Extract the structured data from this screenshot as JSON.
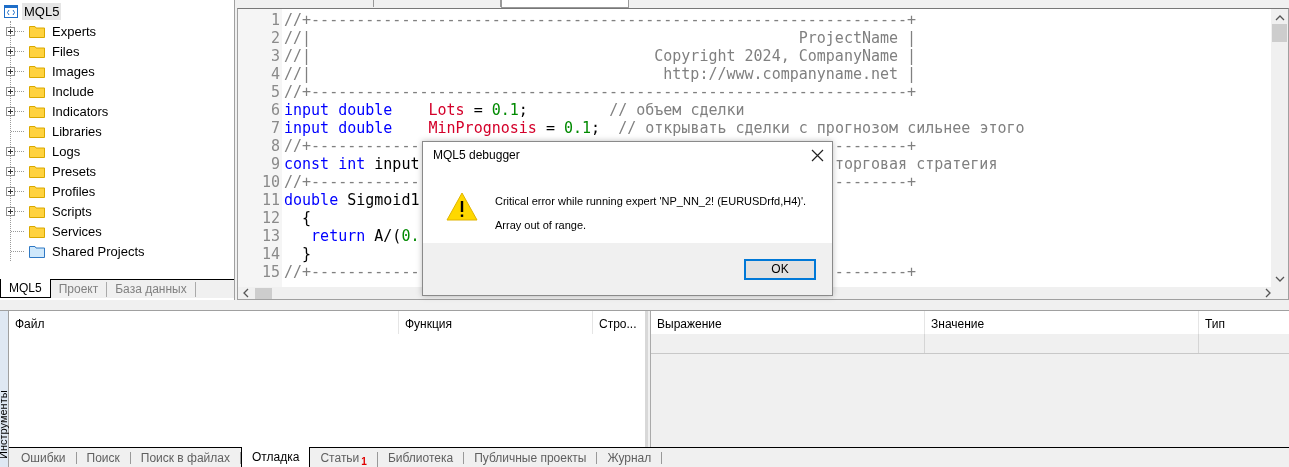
{
  "navigator": {
    "root": {
      "label": "MQL5",
      "selected": true
    },
    "items": [
      {
        "label": "Experts",
        "kind": "folder",
        "expandable": true
      },
      {
        "label": "Files",
        "kind": "folder",
        "expandable": true
      },
      {
        "label": "Images",
        "kind": "folder",
        "expandable": true
      },
      {
        "label": "Include",
        "kind": "folder",
        "expandable": true
      },
      {
        "label": "Indicators",
        "kind": "folder",
        "expandable": true
      },
      {
        "label": "Libraries",
        "kind": "folder",
        "expandable": false
      },
      {
        "label": "Logs",
        "kind": "folder",
        "expandable": true
      },
      {
        "label": "Presets",
        "kind": "folder",
        "expandable": true
      },
      {
        "label": "Profiles",
        "kind": "folder",
        "expandable": true
      },
      {
        "label": "Scripts",
        "kind": "folder",
        "expandable": true
      },
      {
        "label": "Services",
        "kind": "folder",
        "expandable": false
      },
      {
        "label": "Shared Projects",
        "kind": "shared",
        "expandable": false
      }
    ],
    "tabs": [
      {
        "label": "MQL5",
        "selected": true
      },
      {
        "label": "Проект",
        "selected": false
      },
      {
        "label": "База данных",
        "selected": false
      }
    ]
  },
  "editor_tabs": [
    {
      "selected": false
    },
    {
      "selected": false
    },
    {
      "selected": true
    }
  ],
  "code": [
    {
      "number": "1",
      "segments": [
        {
          "kind": "comment",
          "text": "//+------------------------------------------------------------------+"
        }
      ]
    },
    {
      "number": "2",
      "segments": [
        {
          "kind": "comment",
          "text": "//|"
        }
      ],
      "right": [
        {
          "kind": "comment",
          "text": "ProjectName |"
        }
      ]
    },
    {
      "number": "3",
      "segments": [
        {
          "kind": "comment",
          "text": "//|"
        }
      ],
      "right": [
        {
          "kind": "comment",
          "text": "Copyright 2024, CompanyName |"
        }
      ]
    },
    {
      "number": "4",
      "segments": [
        {
          "kind": "comment",
          "text": "//|"
        }
      ],
      "right": [
        {
          "kind": "comment",
          "text": "http://www.companyname.net |"
        }
      ]
    },
    {
      "number": "5",
      "segments": [
        {
          "kind": "comment",
          "text": "//+------------------------------------------------------------------+"
        }
      ]
    },
    {
      "number": "6",
      "segments": [
        {
          "kind": "keyword",
          "text": "input double    "
        },
        {
          "kind": "input",
          "text": "Lots"
        },
        {
          "kind": "plain",
          "text": " = "
        },
        {
          "kind": "number",
          "text": "0.1"
        },
        {
          "kind": "plain",
          "text": ";         "
        },
        {
          "kind": "comment",
          "text": "// объем сделки"
        }
      ]
    },
    {
      "number": "7",
      "segments": [
        {
          "kind": "keyword",
          "text": "input double    "
        },
        {
          "kind": "input",
          "text": "MinPrognosis"
        },
        {
          "kind": "plain",
          "text": " = "
        },
        {
          "kind": "number",
          "text": "0.1"
        },
        {
          "kind": "plain",
          "text": ";  "
        },
        {
          "kind": "comment",
          "text": "// открывать сделки с прогнозом сильнее этого"
        }
      ]
    },
    {
      "number": "8",
      "segments": [
        {
          "kind": "comment",
          "text": "//+------------"
        }
      ],
      "right": [
        {
          "kind": "comment",
          "text": "--------+"
        }
      ]
    },
    {
      "number": "9",
      "segments": [
        {
          "kind": "keyword",
          "text": "const int "
        },
        {
          "kind": "plain",
          "text": "input"
        }
      ],
      "right": [
        {
          "kind": "comment",
          "text": "торговая стратегия"
        }
      ]
    },
    {
      "number": "10",
      "segments": [
        {
          "kind": "comment",
          "text": "//+------------"
        }
      ],
      "right": [
        {
          "kind": "comment",
          "text": "--------+"
        }
      ]
    },
    {
      "number": "11",
      "segments": [
        {
          "kind": "keyword",
          "text": "double "
        },
        {
          "kind": "plain",
          "text": "Sigmoid1"
        }
      ]
    },
    {
      "number": "12",
      "segments": [
        {
          "kind": "plain",
          "text": "  {"
        }
      ]
    },
    {
      "number": "13",
      "segments": [
        {
          "kind": "keyword",
          "text": "   return "
        },
        {
          "kind": "plain",
          "text": "A/("
        },
        {
          "kind": "number",
          "text": "0."
        }
      ]
    },
    {
      "number": "14",
      "segments": [
        {
          "kind": "plain",
          "text": "  }"
        }
      ]
    },
    {
      "number": "15",
      "segments": [
        {
          "kind": "comment",
          "text": "//+------------"
        }
      ],
      "right": [
        {
          "kind": "comment",
          "text": "--------+"
        }
      ]
    }
  ],
  "dialog": {
    "title": "MQL5 debugger",
    "message": "Critical error while running expert 'NP_NN_2! (EURUSDrfd,H4)'.",
    "detail": "Array out of range.",
    "button": "OK"
  },
  "toolbox": {
    "label": "Инструменты",
    "call_stack": {
      "columns": [
        "Файл",
        "Функция",
        "Стро..."
      ]
    },
    "watch": {
      "columns": [
        "Выражение",
        "Значение",
        "Тип"
      ]
    },
    "tabs": [
      {
        "label": "Ошибки",
        "selected": false
      },
      {
        "label": "Поиск",
        "selected": false
      },
      {
        "label": "Поиск в файлах",
        "selected": false
      },
      {
        "label": "Отладка",
        "selected": true
      },
      {
        "label": "Статьи",
        "badge": "1",
        "selected": false
      },
      {
        "label": "Библиотека",
        "selected": false
      },
      {
        "label": "Публичные проекты",
        "selected": false
      },
      {
        "label": "Журнал",
        "selected": false
      }
    ]
  }
}
